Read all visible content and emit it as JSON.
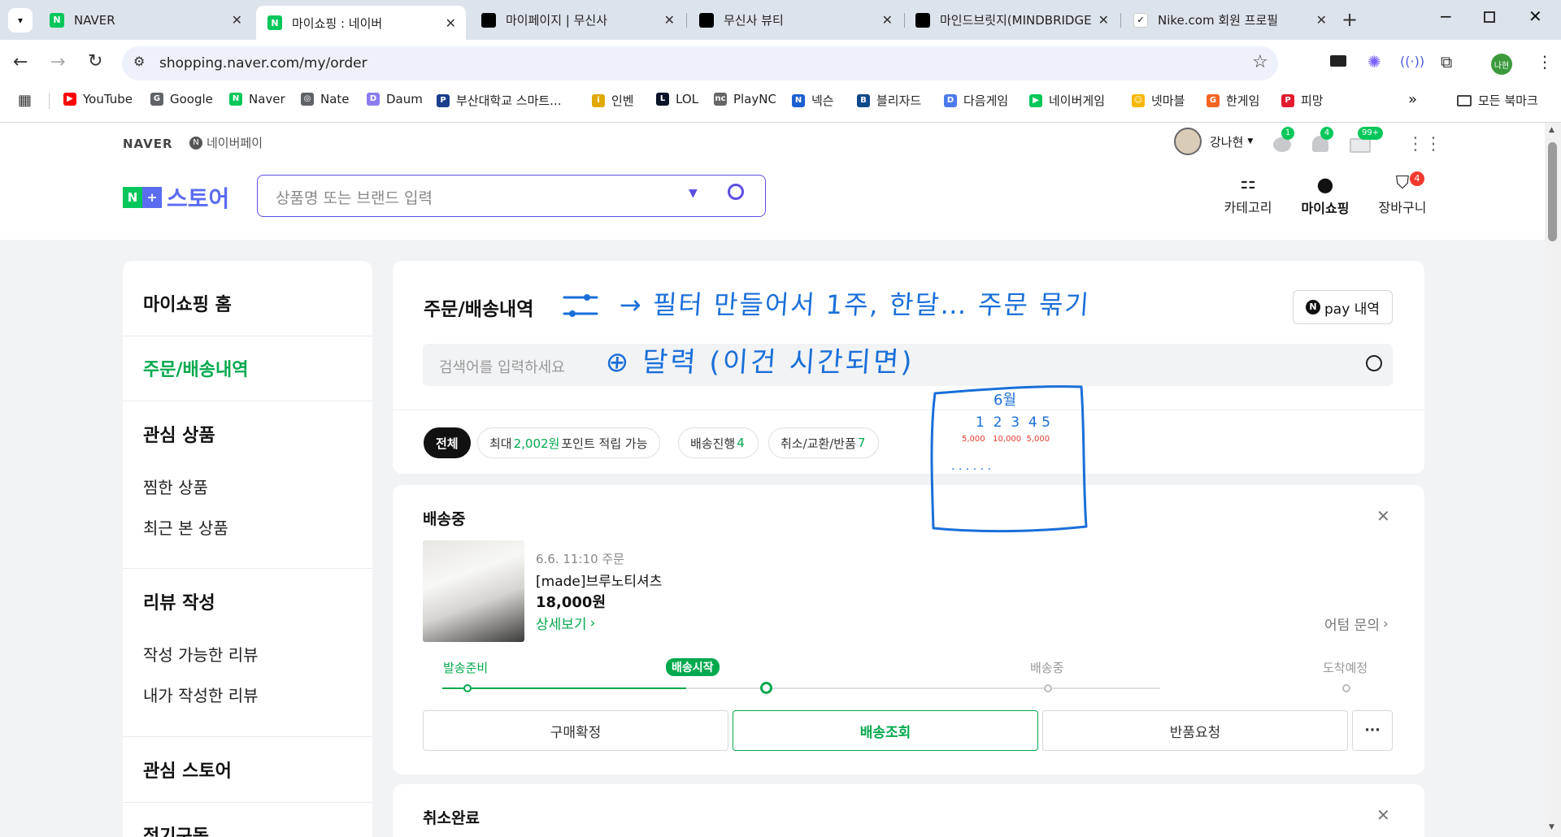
{
  "tabs": [
    {
      "label": "NAVER",
      "favicon": "naver-icon",
      "active": false
    },
    {
      "label": "마이쇼핑 : 네이버",
      "favicon": "naver-icon",
      "active": true
    },
    {
      "label": "마이페이지 | 무신사",
      "favicon": "musinsa-icon",
      "active": false
    },
    {
      "label": "무신사 뷰티",
      "favicon": "musinsa-icon",
      "active": false
    },
    {
      "label": "마인드브릿지(MINDBRIDGE",
      "favicon": "mindbridge-icon",
      "active": false
    },
    {
      "label": "Nike.com 회원 프로필",
      "favicon": "nike-icon",
      "active": false
    }
  ],
  "address": {
    "url": "shopping.naver.com/my/order"
  },
  "profile_badge": "나현",
  "bookmarks": [
    {
      "label": "YouTube",
      "color": "#ff0000",
      "glyph": "▶"
    },
    {
      "label": "Google",
      "color": "#5f6368",
      "glyph": "G"
    },
    {
      "label": "Naver",
      "color": "#03c75a",
      "glyph": "N"
    },
    {
      "label": "Nate",
      "color": "#5f6368",
      "glyph": "◎"
    },
    {
      "label": "Daum",
      "color": "#8a7cf0",
      "glyph": "D"
    },
    {
      "label": "부산대학교 스마트...",
      "color": "#1a3e8c",
      "glyph": "P"
    },
    {
      "label": "인벤",
      "color": "#e0a800",
      "glyph": "i"
    },
    {
      "label": "LOL",
      "color": "#0a1428",
      "glyph": "L"
    },
    {
      "label": "PlayNC",
      "color": "#666666",
      "glyph": "nc"
    },
    {
      "label": "넥슨",
      "color": "#1b5fd1",
      "glyph": "N"
    },
    {
      "label": "블리자드",
      "color": "#0e4a8a",
      "glyph": "B"
    },
    {
      "label": "다음게임",
      "color": "#4b7bec",
      "glyph": "D"
    },
    {
      "label": "네이버게임",
      "color": "#03c75a",
      "glyph": "▶"
    },
    {
      "label": "넷마블",
      "color": "#f5b700",
      "glyph": "☺"
    },
    {
      "label": "한게임",
      "color": "#f26522",
      "glyph": "G"
    },
    {
      "label": "피망",
      "color": "#e21b2c",
      "glyph": "P"
    }
  ],
  "bookmarks_folder": "모든 북마크",
  "header": {
    "naver_logo": "NAVER",
    "npay_link": "네이버페이",
    "user_name": "강나현",
    "badges": {
      "talk": "1",
      "alarm": "4",
      "mail": "99+"
    },
    "store_logo": "스토어",
    "search_placeholder": "상품명 또는 브랜드 입력",
    "nav": {
      "category": "카테고리",
      "myshopping": "마이쇼핑",
      "cart": "장바구니",
      "cart_count": "4"
    }
  },
  "sidebar": {
    "home": "마이쇼핑 홈",
    "orders": "주문/배송내역",
    "interest": "관심 상품",
    "wish": "찜한 상품",
    "recent": "최근 본 상품",
    "review": "리뷰 작성",
    "review_available": "작성 가능한 리뷰",
    "review_written": "내가 작성한 리뷰",
    "store": "관심 스토어",
    "subscription": "정기구독"
  },
  "main": {
    "title": "주문/배송내역",
    "npay_btn": "pay 내역",
    "search_placeholder": "검색어를 입력하세요",
    "chips": {
      "all": "전체",
      "point_pre": "최대 ",
      "point_val": "2,002원",
      "point_post": " 포인트 적립 가능",
      "shipping": "배송진행 ",
      "shipping_count": "4",
      "cancel": "취소/교환/반품 ",
      "cancel_count": "7"
    }
  },
  "order": {
    "status": "배송중",
    "date": "6.6. 11:10 주문",
    "product": "[made]브루노티셔츠",
    "price": "18,000원",
    "detail": "상세보기",
    "inquiry": "어텀 문의",
    "steps": [
      "발송준비",
      "배송시작",
      "배송중",
      "도착예정"
    ],
    "buttons": {
      "confirm": "구매확정",
      "track": "배송조회",
      "return": "반품요청",
      "more": "···"
    }
  },
  "order2": {
    "status": "취소완료"
  },
  "annotation": {
    "line1": "→ 필터 만들어서 1주, 한달… 주문 묶기",
    "line2": "⊕ 달력 (이건 시간되면)",
    "month": "6월",
    "days": "1  2  3  4 5",
    "amounts": "5,000   10,000  5,000",
    "dots": "· · · · · ·"
  },
  "colors": {
    "naver_green": "#03c75a",
    "accent": "#03a94d",
    "ink": "#1a6fd9"
  }
}
